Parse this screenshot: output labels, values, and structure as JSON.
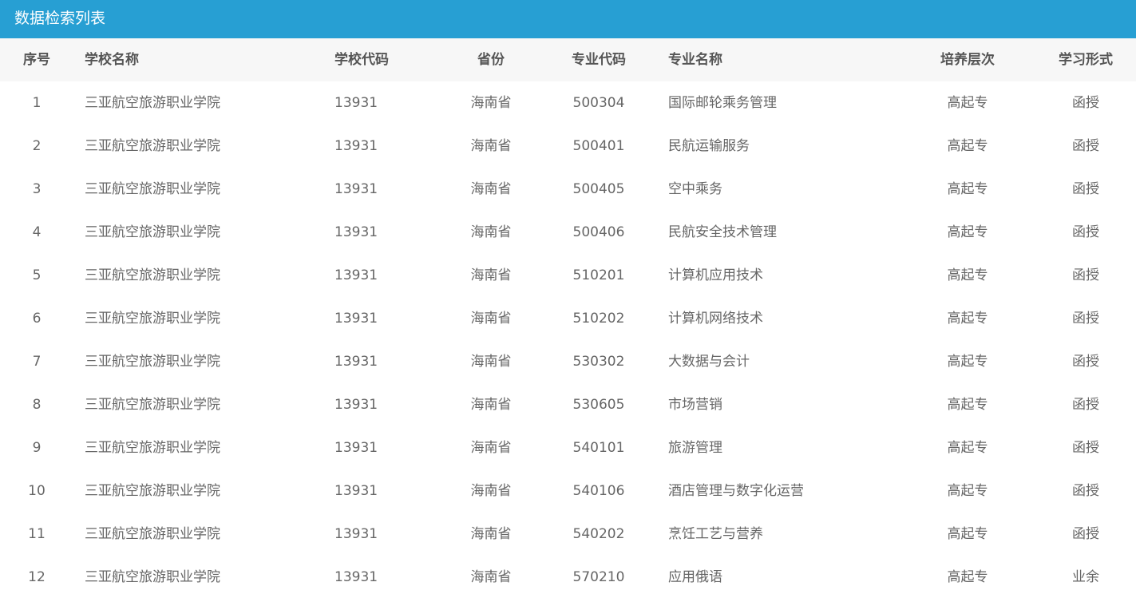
{
  "panel": {
    "title": "数据检索列表"
  },
  "columns": {
    "index": "序号",
    "school_name": "学校名称",
    "school_code": "学校代码",
    "province": "省份",
    "major_code": "专业代码",
    "major_name": "专业名称",
    "level": "培养层次",
    "study_form": "学习形式"
  },
  "rows": [
    {
      "index": "1",
      "school": "三亚航空旅游职业学院",
      "school_code": "13931",
      "province": "海南省",
      "major_code": "500304",
      "major": "国际邮轮乘务管理",
      "level": "高起专",
      "form": "函授"
    },
    {
      "index": "2",
      "school": "三亚航空旅游职业学院",
      "school_code": "13931",
      "province": "海南省",
      "major_code": "500401",
      "major": "民航运输服务",
      "level": "高起专",
      "form": "函授"
    },
    {
      "index": "3",
      "school": "三亚航空旅游职业学院",
      "school_code": "13931",
      "province": "海南省",
      "major_code": "500405",
      "major": "空中乘务",
      "level": "高起专",
      "form": "函授"
    },
    {
      "index": "4",
      "school": "三亚航空旅游职业学院",
      "school_code": "13931",
      "province": "海南省",
      "major_code": "500406",
      "major": "民航安全技术管理",
      "level": "高起专",
      "form": "函授"
    },
    {
      "index": "5",
      "school": "三亚航空旅游职业学院",
      "school_code": "13931",
      "province": "海南省",
      "major_code": "510201",
      "major": "计算机应用技术",
      "level": "高起专",
      "form": "函授"
    },
    {
      "index": "6",
      "school": "三亚航空旅游职业学院",
      "school_code": "13931",
      "province": "海南省",
      "major_code": "510202",
      "major": "计算机网络技术",
      "level": "高起专",
      "form": "函授"
    },
    {
      "index": "7",
      "school": "三亚航空旅游职业学院",
      "school_code": "13931",
      "province": "海南省",
      "major_code": "530302",
      "major": "大数据与会计",
      "level": "高起专",
      "form": "函授"
    },
    {
      "index": "8",
      "school": "三亚航空旅游职业学院",
      "school_code": "13931",
      "province": "海南省",
      "major_code": "530605",
      "major": "市场营销",
      "level": "高起专",
      "form": "函授"
    },
    {
      "index": "9",
      "school": "三亚航空旅游职业学院",
      "school_code": "13931",
      "province": "海南省",
      "major_code": "540101",
      "major": "旅游管理",
      "level": "高起专",
      "form": "函授"
    },
    {
      "index": "10",
      "school": "三亚航空旅游职业学院",
      "school_code": "13931",
      "province": "海南省",
      "major_code": "540106",
      "major": "酒店管理与数字化运营",
      "level": "高起专",
      "form": "函授"
    },
    {
      "index": "11",
      "school": "三亚航空旅游职业学院",
      "school_code": "13931",
      "province": "海南省",
      "major_code": "540202",
      "major": "烹饪工艺与营养",
      "level": "高起专",
      "form": "函授"
    },
    {
      "index": "12",
      "school": "三亚航空旅游职业学院",
      "school_code": "13931",
      "province": "海南省",
      "major_code": "570210",
      "major": "应用俄语",
      "level": "高起专",
      "form": "业余"
    }
  ],
  "colors": {
    "title_bar": "#279fd3",
    "header_bg": "#f7f7f7",
    "header_text": "#555555",
    "body_text": "#666666"
  }
}
